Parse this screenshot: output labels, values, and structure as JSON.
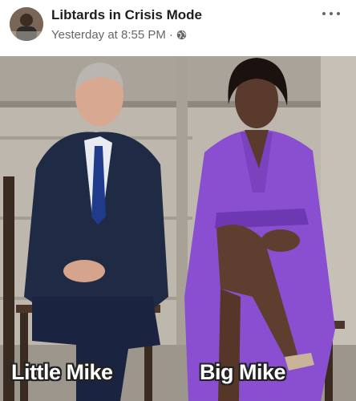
{
  "post": {
    "author": "Libtards in Crisis Mode",
    "timestamp": "Yesterday at 8:55 PM",
    "separator": "·",
    "privacy_icon": "globe-icon",
    "menu_icon": "more-options-icon"
  },
  "meme": {
    "caption_left": "Little Mike",
    "caption_right": "Big Mike"
  },
  "colors": {
    "author_text": "#1c1e21",
    "meta_text": "#65676b",
    "dress_purple": "#8a4fd1",
    "suit_navy": "#1f2a44"
  }
}
